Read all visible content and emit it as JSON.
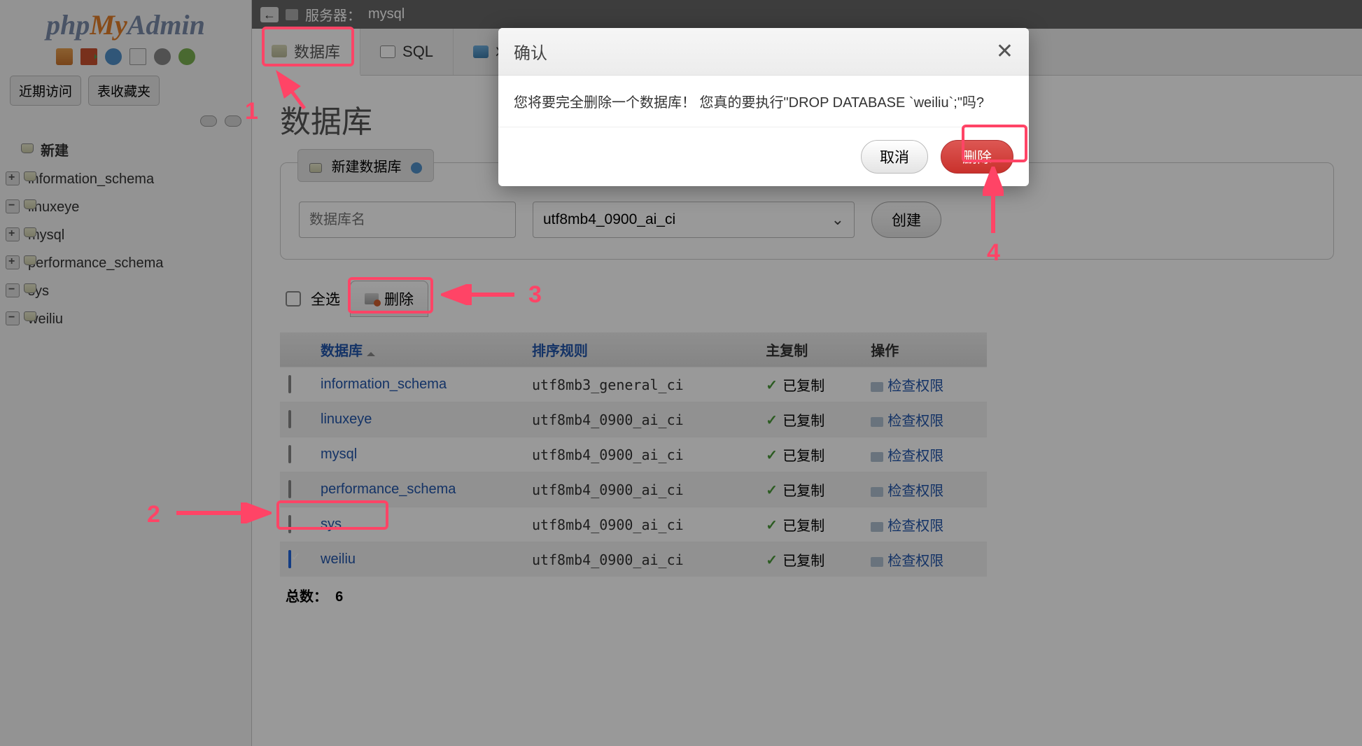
{
  "logo": {
    "php": "php",
    "my": "My",
    "admin": "Admin"
  },
  "sidebar": {
    "tabs": {
      "recent": "近期访问",
      "favorites": "表收藏夹"
    },
    "tree": {
      "new": "新建",
      "items": [
        {
          "label": "information_schema",
          "icon": "plus"
        },
        {
          "label": "linuxeye",
          "icon": "minus"
        },
        {
          "label": "mysql",
          "icon": "plus"
        },
        {
          "label": "performance_schema",
          "icon": "plus"
        },
        {
          "label": "sys",
          "icon": "minus"
        },
        {
          "label": "weiliu",
          "icon": "minus"
        }
      ]
    }
  },
  "server_bar": {
    "label": "服务器： ",
    "name": "mysql"
  },
  "main_tabs": {
    "databases": "数据库",
    "sql": "SQL",
    "status": "状态"
  },
  "page": {
    "title": "数据库"
  },
  "create_panel": {
    "title": "新建数据库",
    "placeholder": "数据库名",
    "collation": "utf8mb4_0900_ai_ci",
    "create_btn": "创建"
  },
  "actions": {
    "select_all": "全选",
    "delete": "删除"
  },
  "table": {
    "headers": {
      "db": "数据库",
      "collation": "排序规则",
      "replication": "主复制",
      "ops": "操作"
    },
    "rows": [
      {
        "name": "information_schema",
        "collation": "utf8mb3_general_ci",
        "repl": "已复制",
        "perm": "检查权限",
        "checked": false,
        "even": false
      },
      {
        "name": "linuxeye",
        "collation": "utf8mb4_0900_ai_ci",
        "repl": "已复制",
        "perm": "检查权限",
        "checked": false,
        "even": true
      },
      {
        "name": "mysql",
        "collation": "utf8mb4_0900_ai_ci",
        "repl": "已复制",
        "perm": "检查权限",
        "checked": false,
        "even": false
      },
      {
        "name": "performance_schema",
        "collation": "utf8mb4_0900_ai_ci",
        "repl": "已复制",
        "perm": "检查权限",
        "checked": false,
        "even": true
      },
      {
        "name": "sys",
        "collation": "utf8mb4_0900_ai_ci",
        "repl": "已复制",
        "perm": "检查权限",
        "checked": false,
        "even": false
      },
      {
        "name": "weiliu",
        "collation": "utf8mb4_0900_ai_ci",
        "repl": "已复制",
        "perm": "检查权限",
        "checked": true,
        "even": true
      }
    ],
    "total": {
      "label": "总数：",
      "count": "6"
    }
  },
  "modal": {
    "title": "确认",
    "body": "您将要完全删除一个数据库！  您真的要执行\"DROP DATABASE `weiliu`;\"吗?",
    "cancel": "取消",
    "delete": "删除"
  },
  "annotations": {
    "l1": "1",
    "l2": "2",
    "l3": "3",
    "l4": "4"
  }
}
